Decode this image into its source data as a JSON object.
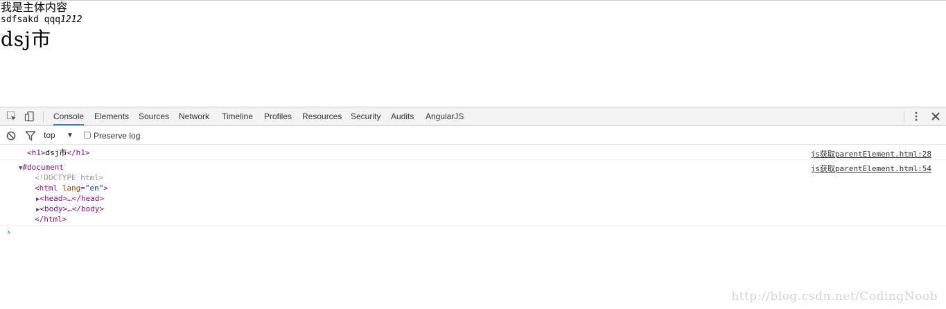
{
  "page": {
    "line1": "我是主体内容",
    "line2_text": "sdfsakd qqq",
    "line2_italic": "1212",
    "heading": "dsj市"
  },
  "devtools": {
    "tabs": [
      "Console",
      "Elements",
      "Sources",
      "Network",
      "Timeline",
      "Profiles",
      "Resources",
      "Security",
      "Audits",
      "AngularJS"
    ],
    "active_tab": "Console",
    "filter": {
      "context": "top",
      "context_arrow": "▼",
      "preserve_log": "Preserve log",
      "preserve_checked": false
    },
    "messages": [
      {
        "open": "<h1>",
        "text": "dsj市",
        "close": "</h1>",
        "source": "js获取parentElement.html:28"
      },
      {
        "root": "#document",
        "source": "js获取parentElement.html:54",
        "doctype": "<!DOCTYPE html>",
        "html_open_tag": "<html",
        "html_attr": "lang",
        "html_eq": "=",
        "html_val": "\"en\"",
        "html_open_end": ">",
        "head_node": "<head>…</head>",
        "body_node": "<body>…</body>",
        "html_close": "</html>"
      }
    ],
    "prompt": "›"
  },
  "watermark": "http://blog.csdn.net/CodingNoob",
  "colors": {
    "accent": "#3879d9",
    "tag": "#881280",
    "attr": "#994500",
    "value": "#1a1aa6"
  }
}
